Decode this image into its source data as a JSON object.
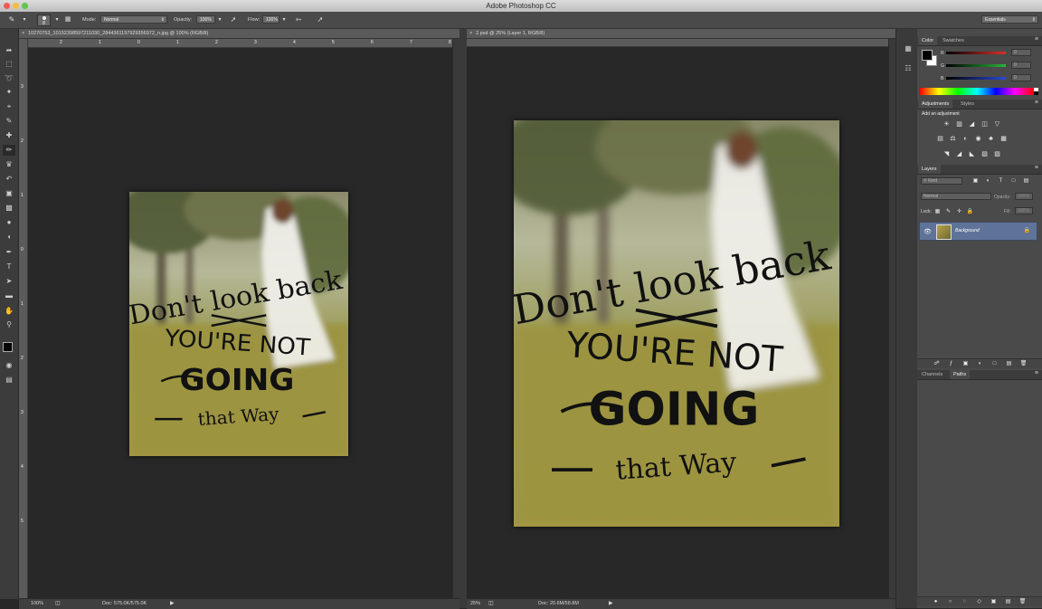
{
  "window": {
    "title": "Adobe Photoshop CC",
    "workspace": "Essentials"
  },
  "options": {
    "brush_size": "8",
    "mode_label": "Mode:",
    "mode_value": "Normal",
    "opacity_label": "Opacity:",
    "opacity_value": "100%",
    "flow_label": "Flow:",
    "flow_value": "100%"
  },
  "documents": [
    {
      "tab": "10270753_10152398597211030_2844361197929356972_n.jpg @ 100% (RGB/8)",
      "zoom": "100%",
      "doc_size": "Doc: 575.0K/575.0K",
      "ruler_h": [
        "2",
        "1",
        "0",
        "1",
        "2",
        "3",
        "4",
        "5",
        "6",
        "7",
        "8"
      ],
      "ruler_v": [
        "3",
        "2",
        "1",
        "0",
        "1",
        "2",
        "3",
        "4",
        "5"
      ]
    },
    {
      "tab": "2.psd @ 25% (Layer 1, RGB/8)",
      "zoom": "25%",
      "doc_size": "Doc: 20.6M/58.8M"
    }
  ],
  "poster": {
    "line1": "Don't look back",
    "line2": "YOU'RE NOT",
    "line3": "GOING",
    "line4": "that Way"
  },
  "color_panel": {
    "tabs": [
      "Color",
      "Swatches"
    ],
    "r_label": "R",
    "g_label": "G",
    "b_label": "B",
    "r": "0",
    "g": "0",
    "b": "0"
  },
  "adjustments_panel": {
    "tabs": [
      "Adjustments",
      "Styles"
    ],
    "heading": "Add an adjustment"
  },
  "layers_panel": {
    "tab": "Layers",
    "filter": "Kind",
    "blend": "Normal",
    "opacity_label": "Opacity:",
    "opacity_value": "100%",
    "lock_label": "Lock:",
    "fill_label": "Fill:",
    "fill_value": "100%",
    "layers": [
      {
        "name": "Background",
        "visible": true,
        "locked": true
      }
    ]
  },
  "bottom_panel": {
    "tabs": [
      "Channels",
      "Paths"
    ]
  },
  "colors": {
    "accent_selected_layer": "#5f7398",
    "red_slider": "#d9302a",
    "green_slider": "#2bb33a",
    "blue_slider": "#2a48d9"
  }
}
